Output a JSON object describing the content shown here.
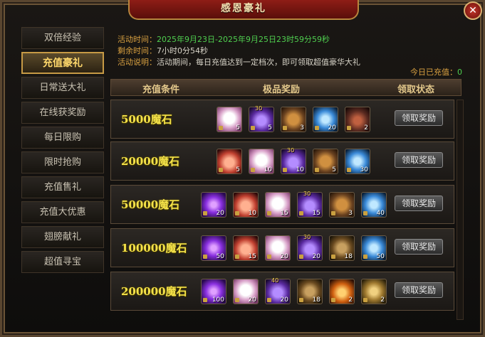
{
  "window": {
    "title": "感恩豪礼"
  },
  "sidebar": {
    "items": [
      {
        "label": "双倍经验"
      },
      {
        "label": "充值豪礼"
      },
      {
        "label": "日常送大礼"
      },
      {
        "label": "在线获奖励"
      },
      {
        "label": "每日限购"
      },
      {
        "label": "限时抢购"
      },
      {
        "label": "充值售礼"
      },
      {
        "label": "充值大优惠"
      },
      {
        "label": "翅膀献礼"
      },
      {
        "label": "超值寻宝"
      }
    ],
    "active_index": 1
  },
  "info": {
    "time_key": "活动时间：",
    "time_val": "2025年9月23日-2025年9月25日23时59分59秒",
    "remain_key": "剩余时间：",
    "remain_val": "7小时0分54秒",
    "desc_key": "活动说明：",
    "desc_val": "活动期间，每日充值达到一定档次，即可领取超值豪华大礼",
    "today_label": "今日已充值：",
    "today_value": "0"
  },
  "columns": {
    "condition": "充值条件",
    "rewards": "极品奖励",
    "status": "领取状态"
  },
  "rows": [
    {
      "condition": "5000魔石",
      "claim_label": "领取奖励",
      "items": [
        {
          "icon": "fox-mount-icon",
          "count": "5"
        },
        {
          "icon": "purple-egg-icon",
          "count": "5",
          "star": "30"
        },
        {
          "icon": "bronze-badge-icon",
          "count": "3"
        },
        {
          "icon": "blue-gem-icon",
          "count": "20"
        },
        {
          "icon": "medal-icon",
          "count": "2"
        }
      ]
    },
    {
      "condition": "20000魔石",
      "claim_label": "领取奖励",
      "items": [
        {
          "icon": "red-wing-icon",
          "count": "5"
        },
        {
          "icon": "fox-mount-icon",
          "count": "10"
        },
        {
          "icon": "purple-egg-icon",
          "count": "10",
          "star": "30"
        },
        {
          "icon": "bronze-badge-icon",
          "count": "5"
        },
        {
          "icon": "blue-gem-icon",
          "count": "30"
        }
      ]
    },
    {
      "condition": "50000魔石",
      "claim_label": "领取奖励",
      "items": [
        {
          "icon": "purple-orb-icon",
          "count": "20"
        },
        {
          "icon": "red-wing-icon",
          "count": "10"
        },
        {
          "icon": "fox-mount-icon",
          "count": "15"
        },
        {
          "icon": "purple-egg-icon",
          "count": "15",
          "star": "30"
        },
        {
          "icon": "bronze-badge-icon",
          "count": "3"
        },
        {
          "icon": "blue-gem-icon",
          "count": "40"
        }
      ]
    },
    {
      "condition": "100000魔石",
      "claim_label": "领取奖励",
      "items": [
        {
          "icon": "purple-orb-icon",
          "count": "50"
        },
        {
          "icon": "red-wing-icon",
          "count": "15"
        },
        {
          "icon": "fox-mount-icon",
          "count": "20"
        },
        {
          "icon": "purple-egg-icon",
          "count": "20",
          "star": "30"
        },
        {
          "icon": "skill-book-icon",
          "count": "18"
        },
        {
          "icon": "blue-gem-icon",
          "count": "50"
        }
      ]
    },
    {
      "condition": "200000魔石",
      "claim_label": "领取奖励",
      "items": [
        {
          "icon": "purple-orb-icon",
          "count": "100"
        },
        {
          "icon": "fox-mount-icon",
          "count": "20"
        },
        {
          "icon": "purple-egg-icon",
          "count": "20",
          "star": "40"
        },
        {
          "icon": "skill-book-icon",
          "count": "18"
        },
        {
          "icon": "flame-crystal-icon",
          "count": "2"
        },
        {
          "icon": "treasure-icon",
          "count": "2"
        }
      ]
    }
  ]
}
